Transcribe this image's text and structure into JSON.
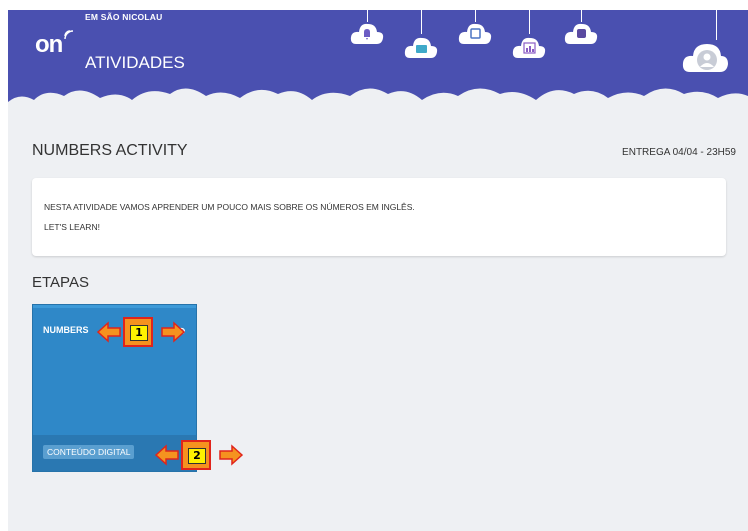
{
  "header": {
    "school": "EM SÃO NICOLAU",
    "logo": "on",
    "title": "ATIVIDADES",
    "cloud_icons": [
      "bell-icon",
      "mail-icon",
      "calendar-icon",
      "chart-icon",
      "backpack-icon"
    ]
  },
  "activity": {
    "title": "NUMBERS ACTIVITY",
    "deadline": "ENTREGA 04/04 - 23H59",
    "description": [
      "NESTA ATIVIDADE VAMOS APRENDER UM POUCO MAIS SOBRE OS NÚMEROS EM INGLÊS.",
      "LET'S LEARN!"
    ]
  },
  "steps": {
    "title": "ETAPAS",
    "items": [
      {
        "name": "NUMBERS",
        "tag": "CONTEÚDO DIGITAL"
      }
    ]
  },
  "markers": [
    "1",
    "2"
  ],
  "colors": {
    "header": "#4a50b0",
    "card": "#2f88c8",
    "page": "#eef0f3"
  }
}
